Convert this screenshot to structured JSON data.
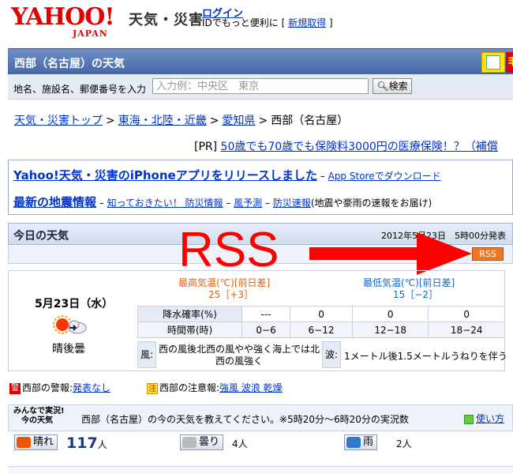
{
  "header": {
    "logo_text": "YAHOO!",
    "logo_sub": "JAPAN",
    "service_name": "天気・災害",
    "login_label": "ログイン",
    "login_sub_prefix": "IDでもっと便利に [ ",
    "signup_label": "新規取得",
    "login_sub_suffix": " ]"
  },
  "titlebar": {
    "title": "西部（名古屋）の天気",
    "badge": "毛"
  },
  "search": {
    "label": "地名、施設名、郵便番号を入力",
    "placeholder": "入力例：中央区　東京",
    "button": "検索"
  },
  "breadcrumb": {
    "items": [
      "天気・災害トップ",
      "東海・北陸・近畿",
      "愛知県"
    ],
    "separator": ">",
    "current": "西部（名古屋）"
  },
  "pr": {
    "tag": "[PR]",
    "link": "50歳でも70歳でも保険料3000円の医療保険！？（補償"
  },
  "notice": {
    "headline": "Yahoo!天気・災害のiPhoneアプリをリリースしました",
    "headline_sub": "App Storeでダウンロード",
    "quake": "最新の地震情報",
    "link1": "知っておきたい！ 防災情報",
    "link2": "風予測",
    "link3": "防災速報",
    "tail": "(地震や豪雨の速報をお届け)",
    "dash": " – "
  },
  "today": {
    "title": "今日の天気",
    "issued": "2012年5月23日　5時00分発表",
    "rss_label": "RSS",
    "annotation": "RSS"
  },
  "weather": {
    "date": "5月23日（水）",
    "icon": "sun-cloud-icon",
    "description": "晴後曇",
    "high_label": "最高気温(℃)[前日差]",
    "high_value": "25［+3］",
    "low_label": "最低気温(℃)[前日差]",
    "low_value": "15［−2］",
    "rain_header": "降水確率(%)",
    "rain_values": [
      "---",
      "0",
      "0",
      "0"
    ],
    "time_header": "時間帯(時)",
    "time_values": [
      "0−6",
      "6−12",
      "12−18",
      "18−24"
    ],
    "wind_label": "風:",
    "wind_text": "西の風後北西の風やや強く海上では北西の風強く",
    "wave_label": "波:",
    "wave_text": "1メートル後1.5メートルうねりを伴う"
  },
  "warnings": {
    "warning_icon": "警",
    "warning_label": "西部の警報:",
    "warning_value": "発表なし",
    "advisory_icon": "注",
    "advisory_label": "西部の注意報:",
    "advisory_value": "強風 波浪 乾燥"
  },
  "minna": {
    "logo_line1": "みんなで実況!",
    "logo_line2": "今の天気",
    "question": "西部（名古屋）の今の天気を教えてください。※5時20分〜6時20分の実況数",
    "help": "使い方",
    "votes": [
      {
        "label": "晴れ",
        "count": "117",
        "unit": "人",
        "color": "#ee5500"
      },
      {
        "label": "曇り",
        "count": "4",
        "unit": "人",
        "color": "#999999"
      },
      {
        "label": "雨",
        "count": "2",
        "unit": "人",
        "color": "#3377cc"
      }
    ]
  },
  "colors": {
    "accent": "#4467a8",
    "link": "#0033cc",
    "brand": "#e00000",
    "rss": "#ee7722"
  }
}
